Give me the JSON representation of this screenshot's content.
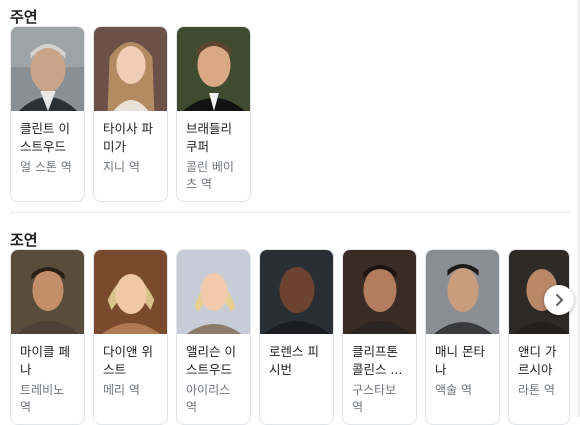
{
  "lead": {
    "title": "주연",
    "cast": [
      {
        "name": "클린트 이스트우드",
        "role": "얼 스톤 역"
      },
      {
        "name": "타이사 파미가",
        "role": "지니 역"
      },
      {
        "name": "브래들리 쿠퍼",
        "role": "콜린 베이츠 역"
      }
    ]
  },
  "supporting": {
    "title": "조연",
    "cast": [
      {
        "name": "마이클 페나",
        "role": "트레비노 역"
      },
      {
        "name": "다이앤 위스트",
        "role": "메리 역"
      },
      {
        "name": "앨리슨 이스트우드",
        "role": "아이리스 역"
      },
      {
        "name": "로렌스 피시번",
        "role": ""
      },
      {
        "name": "클리프톤 콜린스 ...",
        "role": "구스타보 역"
      },
      {
        "name": "매니 몬타나",
        "role": "액술 역"
      },
      {
        "name": "앤디 가르시아",
        "role": "라톤 역"
      }
    ]
  },
  "icons": {
    "next": "chevron-right-icon"
  }
}
